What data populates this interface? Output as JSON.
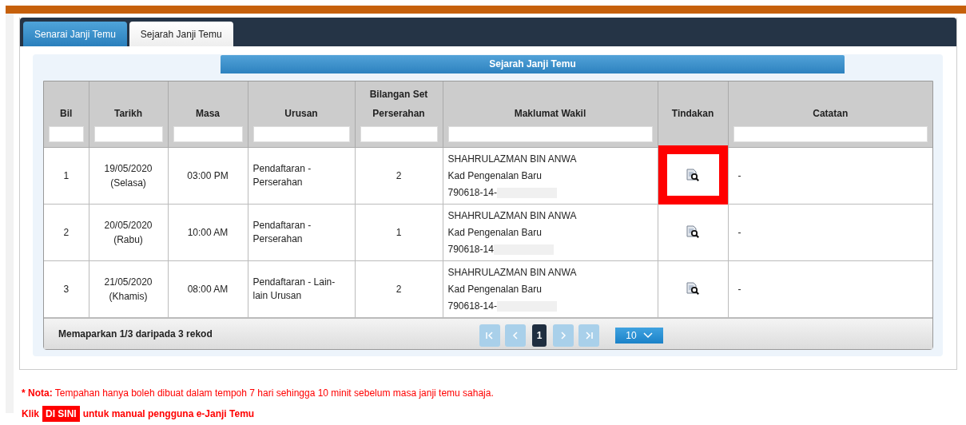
{
  "tabs": [
    {
      "label": "Senarai Janji Temu",
      "selected": false
    },
    {
      "label": "Sejarah Janji Temu",
      "selected": true
    }
  ],
  "panel_title": "Sejarah Janji Temu",
  "table": {
    "columns": [
      {
        "label": "Bil",
        "filter": true
      },
      {
        "label": "Tarikh",
        "filter": true
      },
      {
        "label": "Masa",
        "filter": true
      },
      {
        "label": "Urusan",
        "filter": true
      },
      {
        "label": "Bilangan Set Perserahan",
        "filter": true
      },
      {
        "label": "Maklumat Wakil",
        "filter": true
      },
      {
        "label": "Tindakan",
        "filter": false
      },
      {
        "label": "Catatan",
        "filter": true
      }
    ],
    "rows": [
      {
        "bil": "1",
        "date": "19/05/2020",
        "day": "(Selasa)",
        "time": "03:00 PM",
        "matter": "Pendaftaran - Perserahan",
        "sets": "2",
        "agent_name": "SHAHRULAZMAN BIN ANWA",
        "id_type": "Kad Pengenalan Baru",
        "id_number": "790618-14-",
        "redacted": true,
        "highlighted": true,
        "note": "-"
      },
      {
        "bil": "2",
        "date": "20/05/2020",
        "day": "(Rabu)",
        "time": "10:00 AM",
        "matter": "Pendaftaran - Perserahan",
        "sets": "1",
        "agent_name": "SHAHRULAZMAN BIN ANWA",
        "id_type": "Kad Pengenalan Baru",
        "id_number": "790618-14",
        "redacted": true,
        "highlighted": false,
        "note": "-"
      },
      {
        "bil": "3",
        "date": "21/05/2020",
        "day": "(Khamis)",
        "time": "08:00 AM",
        "matter": "Pendaftaran - Lain-lain Urusan",
        "sets": "2",
        "agent_name": "SHAHRULAZMAN BIN ANWA",
        "id_type": "Kad Pengenalan Baru",
        "id_number": "790618-14-",
        "redacted": true,
        "highlighted": false,
        "note": "-"
      }
    ]
  },
  "footer": {
    "summary": "Memaparkan 1/3 daripada 3 rekod",
    "pager": [
      {
        "kind": "first",
        "disabled": true
      },
      {
        "kind": "prev",
        "disabled": true
      },
      {
        "kind": "page",
        "label": "1",
        "selected": true
      },
      {
        "kind": "next",
        "disabled": true
      },
      {
        "kind": "last",
        "disabled": true
      }
    ],
    "page_size": "10"
  },
  "note": {
    "label": "* Nota:",
    "text": "Tempahan hanya boleh dibuat dalam tempoh 7 hari sehingga 10 minit sebelum masa janji temu sahaja."
  },
  "manual": {
    "before": "Klik",
    "link": "DI SINI",
    "after": "untuk manual pengguna e-Janji Temu"
  }
}
